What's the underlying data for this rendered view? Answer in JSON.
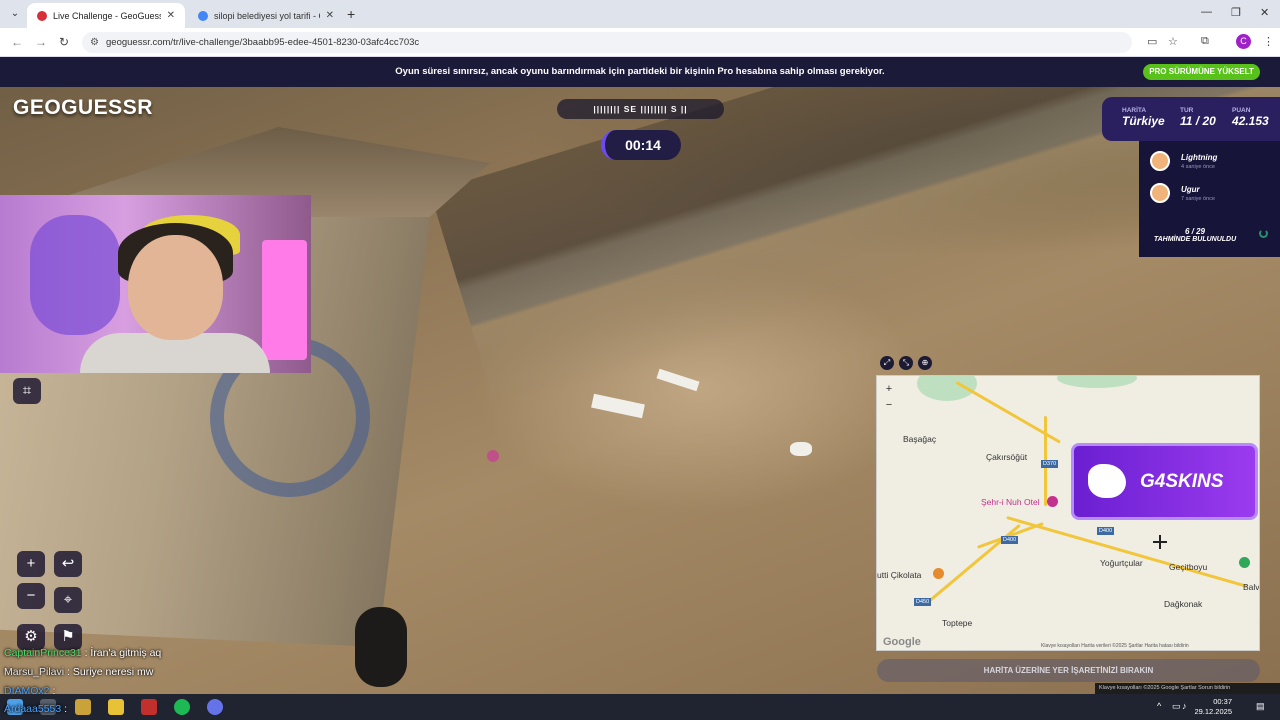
{
  "browser": {
    "tabs": [
      {
        "title": "Live Challenge - GeoGuessr",
        "active": true
      },
      {
        "title": "silopi belediyesi yol tarifi - Goo",
        "active": false
      }
    ],
    "url": "geoguessr.com/tr/live-challenge/3baabb95-edee-4501-8230-03afc4cc703c",
    "profile_initial": "C"
  },
  "banner": {
    "message": "Oyun süresi sınırsız, ancak oyunu barındırmak için partideki bir kişinin Pro hesabına sahip olması gerekiyor.",
    "button": "PRO SÜRÜMÜNE YÜKSELT"
  },
  "logo": "GEOGUESSR",
  "compass": {
    "left": "SE",
    "right": "S"
  },
  "timer": "00:14",
  "stats": {
    "map_label": "HARİTA",
    "map_value": "Türkiye",
    "round_label": "TUR",
    "round_value": "11 / 20",
    "score_label": "PUAN",
    "score_value": "42.153"
  },
  "players": [
    {
      "name": "Lightning",
      "time": "4 saniye önce"
    },
    {
      "name": "Ugur",
      "time": "7 saniye önce"
    }
  ],
  "guess_status": {
    "count": "6 / 29",
    "label": "TAHMİNDE BULUNULDU"
  },
  "chat": [
    {
      "user": "CaptainPrince31",
      "msg": ": İran'a gitmiş aq"
    },
    {
      "user": "Marsu_Pilavi",
      "msg": ": Suriye neresi mw"
    },
    {
      "user": "DIAMOx2",
      "msg": ":"
    },
    {
      "user": "Ardaaa5553",
      "msg": ":"
    }
  ],
  "map": {
    "labels": {
      "basagac": "Başağaç",
      "cakirsogut": "Çakırsöğüt",
      "sehri": "Şehr-i Nuh Otel",
      "yogurtcular": "Yoğurtçular",
      "gecitboyu": "Geçitboyu",
      "dagkonak": "Dağkonak",
      "toptepe": "Toptepe",
      "cikolata": "utti Çikolata",
      "balv": "Balv"
    },
    "shields": {
      "d370": "D370",
      "d400a": "D400",
      "d400b": "D400",
      "d450": "D450"
    },
    "footer": "Klavye kısayolları   Harita verileri ©2025   Şartlar   Harita hatası bildirin",
    "google": "Google",
    "place_button": "HARİTA ÜZERİNE YER İŞARETİNİZİ BIRAKIN"
  },
  "ad": "G4SKINS",
  "bottom_strip": "Klavye kısayolları  ©2025 Google  Şartlar  Sorun bildirin",
  "taskbar": {
    "time": "00:37",
    "date": "29.12.2025"
  }
}
